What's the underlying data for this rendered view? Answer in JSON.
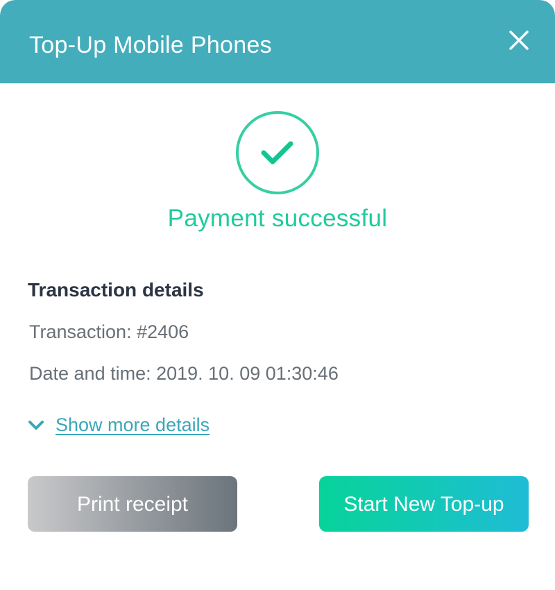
{
  "header": {
    "title": "Top-Up Mobile Phones",
    "close_icon": "close-icon",
    "background_color": "#43adbb"
  },
  "status": {
    "icon": "check-circle-icon",
    "message": "Payment successful",
    "color": "#1fcb9b"
  },
  "details": {
    "title": "Transaction details",
    "transaction": "Transaction: #2406",
    "datetime": "Date and time: 2019. 10. 09 01:30:46",
    "show_more_icon": "chevron-down-icon",
    "show_more_label": "Show more details",
    "link_color": "#3aa6b9"
  },
  "actions": {
    "print_label": "Print receipt",
    "start_label": "Start New Top-up"
  }
}
